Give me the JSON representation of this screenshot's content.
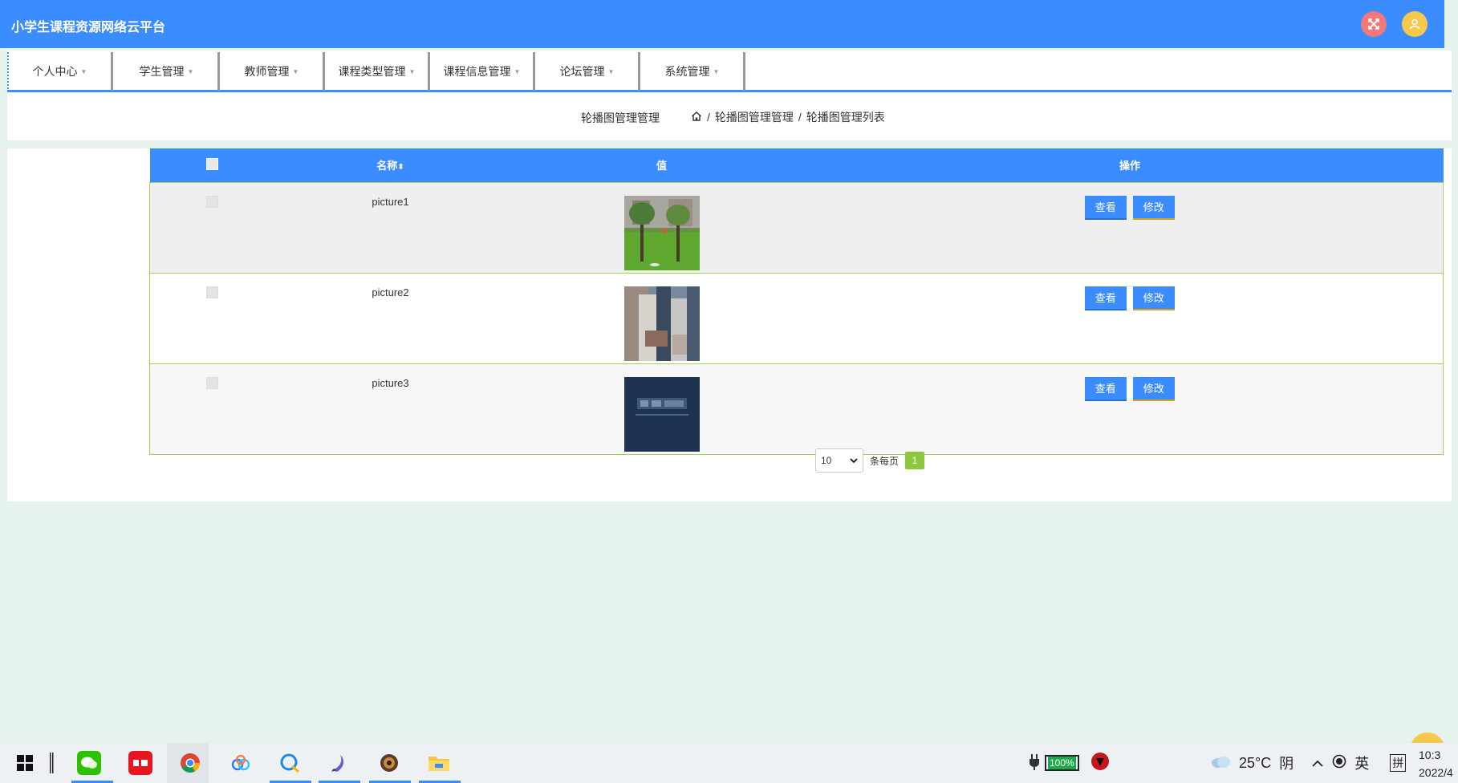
{
  "header": {
    "title": "小学生课程资源网络云平台",
    "colors": {
      "bar": "#3b8cff",
      "close": "#f3787a",
      "user": "#f7c94a"
    }
  },
  "nav": {
    "items": [
      {
        "label": "个人中心"
      },
      {
        "label": "学生管理"
      },
      {
        "label": "教师管理"
      },
      {
        "label": "课程类型管理"
      },
      {
        "label": "课程信息管理"
      },
      {
        "label": "论坛管理"
      },
      {
        "label": "系统管理"
      }
    ]
  },
  "breadcrumb": {
    "page_title": "轮播图管理管理",
    "path_1": "轮播图管理管理",
    "path_2": "轮播图管理列表",
    "separator": "/"
  },
  "table": {
    "columns": {
      "name": "名称",
      "value": "值",
      "actions": "操作"
    },
    "rows": [
      {
        "name": "picture1",
        "thumb_icon": "park-photo",
        "view": "查看",
        "edit": "修改"
      },
      {
        "name": "picture2",
        "thumb_icon": "building-photo",
        "view": "查看",
        "edit": "修改"
      },
      {
        "name": "picture3",
        "thumb_icon": "dark-banner-photo",
        "view": "查看",
        "edit": "修改"
      }
    ]
  },
  "pager": {
    "page_size": "10",
    "per_page_label": "条每页",
    "current_page": "1"
  },
  "taskbar": {
    "battery": "100%",
    "weather": "25°C",
    "condition": "阴",
    "ime_lang": "英",
    "ime_mode": "拼",
    "time": "10:3",
    "date": "2022/4"
  }
}
